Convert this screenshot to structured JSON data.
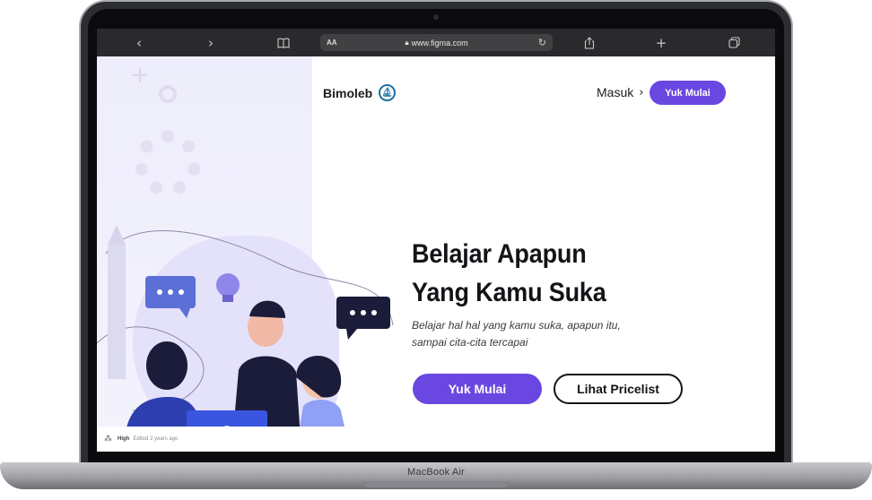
{
  "device": {
    "label": "MacBook Air"
  },
  "browser": {
    "url": "www.figma.com",
    "aa_label": "AA",
    "back_icon": "chevron-left-icon",
    "forward_icon": "chevron-right-icon",
    "book_icon": "book-icon",
    "share_icon": "share-icon",
    "add_icon": "plus-icon",
    "tabs_icon": "tabs-icon"
  },
  "header": {
    "brand": "Bimoleb",
    "login": "Masuk",
    "cta": "Yuk Mulai"
  },
  "hero": {
    "title_line1": "Belajar Apapun",
    "title_line2": "Yang Kamu Suka",
    "subtitle_line1": "Belajar  hal hal yang kamu suka, apapun itu,",
    "subtitle_line2": "sampai cita-cita tercapai",
    "primary_button": "Yuk Mulai",
    "secondary_button": "Lihat Pricelist"
  },
  "figma": {
    "file_name": "High",
    "edited": "Edited 2 years ago"
  },
  "colors": {
    "accent": "#6a47e0",
    "text": "#141418",
    "illustration_bg": "#eeedfb"
  }
}
